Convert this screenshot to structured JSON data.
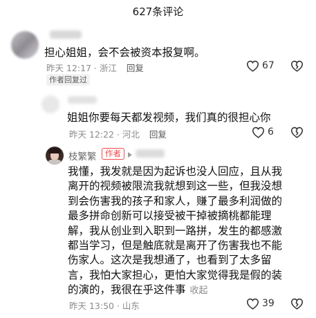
{
  "header": {
    "title": "627条评论"
  },
  "comments": [
    {
      "text": "担心姐姐，会不会被资本报复啊。",
      "time": "昨天 12:17 · 浙江",
      "reply": "回复",
      "likes": "67",
      "badge": "作者回复过"
    },
    {
      "text": "姐姐你要每天都发视频，我们真的很担心你",
      "time": "昨天 12:22 · 河北",
      "reply": "回复",
      "likes": "6"
    },
    {
      "name": "枝繁繁",
      "author_tag": "作者",
      "lines": [
        "我懂，我发就是因为起诉也没人回应，且从我",
        "离开的视频被限流我就想到这一些，但我没想",
        "到会伤害我的孩子和家人，赚了最多利润做的",
        "最多拼命创新可以接受被干掉被摘桃都能理",
        "解，我从创业到入职到一路拼，发生的都感激",
        "都当学习，但是触底就是离开了伤害我也不能",
        "伤家人。这次是我想通了，也看到了太多留",
        "言，我怕大家担心，更怕大家觉得我是假的装",
        "的演的，我很在乎这件事"
      ],
      "collapse": "收起",
      "time": "昨天 13:50 · 山东",
      "likes": "39"
    }
  ],
  "colors": {
    "author_tag": "#f04a4a",
    "meta": "#8a8a8a"
  }
}
